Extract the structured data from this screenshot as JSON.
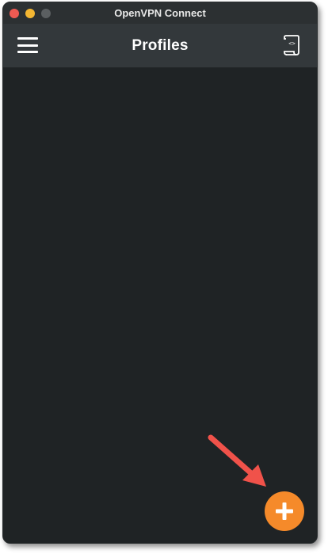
{
  "window": {
    "title": "OpenVPN Connect"
  },
  "appbar": {
    "title": "Profiles"
  },
  "icons": {
    "menu": "hamburger-menu-icon",
    "import": "import-file-icon",
    "add": "plus-icon",
    "annotation": "red-arrow-annotation"
  },
  "colors": {
    "titlebar": "#2c3032",
    "appbar": "#33383b",
    "background": "#1f2325",
    "fab": "#f58a2a",
    "arrow": "#f0524a"
  }
}
